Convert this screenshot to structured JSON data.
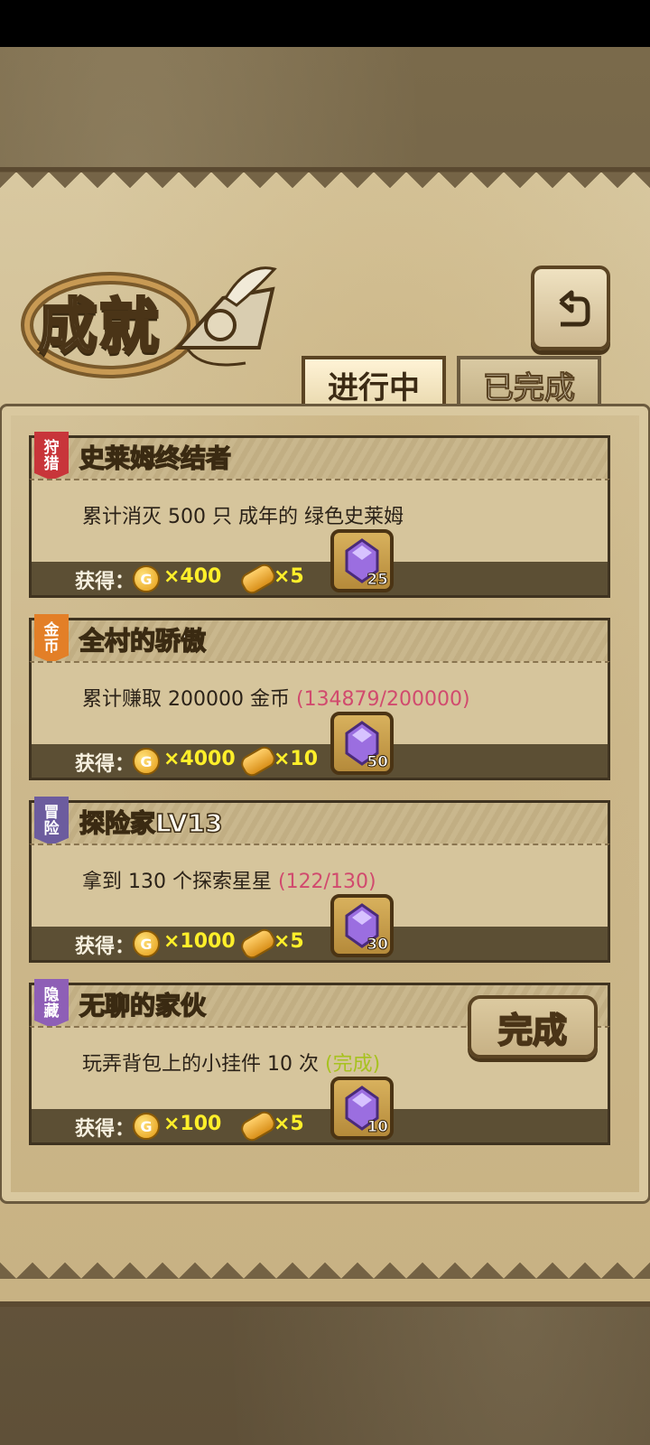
{
  "screen": {
    "title": "成就",
    "back_button_icon": "back-arrow-icon",
    "tabs": [
      {
        "label": "进行中",
        "active": true
      },
      {
        "label": "已完成",
        "active": false
      }
    ]
  },
  "achievements": [
    {
      "badge_line1": "狩",
      "badge_line2": "猎",
      "badge_color": "#c8353a",
      "title": "史莱姆终结者",
      "description": "累计消灭 500 只 成年的 绿色史莱姆",
      "progress": "",
      "reward_label": "获得：",
      "gold": "×400",
      "bread": "×5",
      "gem": "25"
    },
    {
      "badge_line1": "金",
      "badge_line2": "币",
      "badge_color": "#e37f27",
      "title": "全村的骄傲",
      "description": "累计赚取 200000 金币",
      "progress": "(134879/200000)",
      "reward_label": "获得：",
      "gold": "×4000",
      "bread": "×10",
      "gem": "50"
    },
    {
      "badge_line1": "冒",
      "badge_line2": "险",
      "badge_color": "#6c5c9e",
      "title": "探险家LV13",
      "description": "拿到 130 个探索星星",
      "progress": "(122/130)",
      "reward_label": "获得：",
      "gold": "×1000",
      "bread": "×5",
      "gem": "30"
    },
    {
      "badge_line1": "隐",
      "badge_line2": "藏",
      "badge_color": "#8e5fb6",
      "title": "无聊的家伙",
      "description": "玩弄背包上的小挂件 10 次",
      "progress": "(完成)",
      "reward_label": "获得：",
      "gold": "×100",
      "bread": "×5",
      "gem": "10",
      "complete_button": "完成"
    }
  ],
  "icons": {
    "coin": "gold-coin-icon",
    "bread": "bread-icon",
    "gem": "purple-gem-icon"
  }
}
